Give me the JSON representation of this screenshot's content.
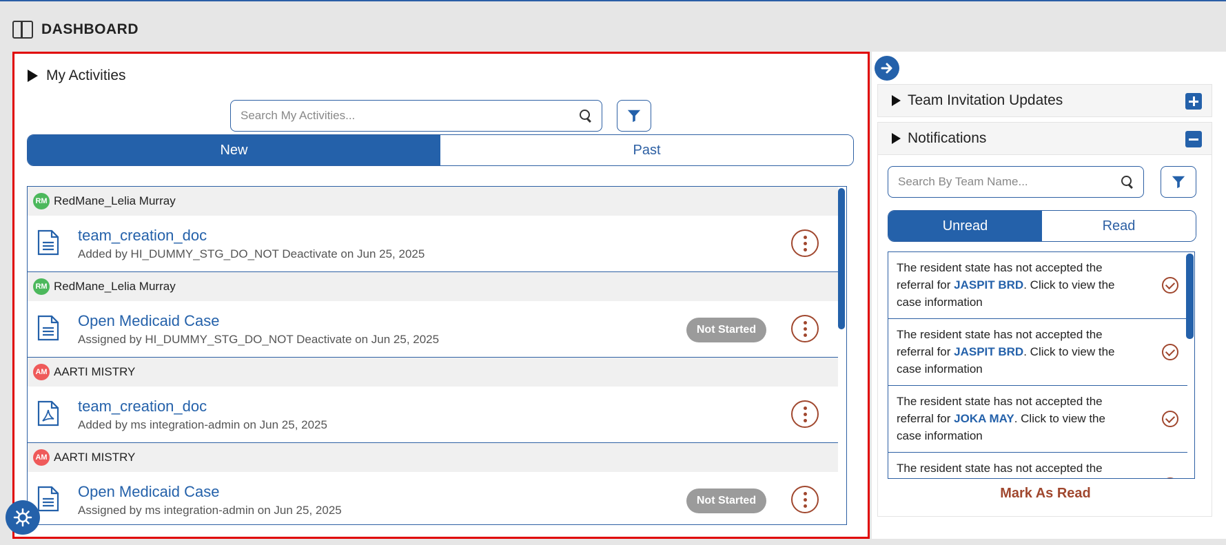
{
  "header": {
    "title": "DASHBOARD"
  },
  "activities": {
    "section_title": "My Activities",
    "search_placeholder": "Search My Activities...",
    "tabs": [
      {
        "label": "New",
        "active": true
      },
      {
        "label": "Past",
        "active": false
      }
    ],
    "items": [
      {
        "initials": "RM",
        "owner": "RedMane_Lelia Murray",
        "title": "team_creation_doc",
        "meta": "Added by HI_DUMMY_STG_DO_NOT Deactivate  on Jun 25, 2025",
        "status": "",
        "icon": "document-icon"
      },
      {
        "initials": "RM",
        "owner": "RedMane_Lelia Murray",
        "title": "Open Medicaid Case",
        "meta": "Assigned by HI_DUMMY_STG_DO_NOT Deactivate  on Jun 25, 2025",
        "status": "Not Started",
        "icon": "document-icon"
      },
      {
        "initials": "AM",
        "owner": "AARTI MISTRY",
        "title": "team_creation_doc",
        "meta": "Added by ms integration-admin  on Jun 25, 2025",
        "status": "",
        "icon": "pdf-icon"
      },
      {
        "initials": "AM",
        "owner": "AARTI MISTRY",
        "title": "Open Medicaid Case",
        "meta": "Assigned by ms integration-admin  on Jun 25, 2025",
        "status": "Not Started",
        "icon": "document-icon"
      }
    ]
  },
  "right": {
    "team_invitations_title": "Team Invitation Updates",
    "notifications_title": "Notifications",
    "search_placeholder": "Search By Team Name...",
    "tabs": [
      {
        "label": "Unread",
        "active": true
      },
      {
        "label": "Read",
        "active": false
      }
    ],
    "notifications": [
      {
        "prefix": "The resident state has not accepted the referral for ",
        "name": "JASPIT BRD",
        "suffix": ". Click to view the case information"
      },
      {
        "prefix": "The resident state has not accepted the referral for ",
        "name": "JASPIT BRD",
        "suffix": ". Click to view the case information"
      },
      {
        "prefix": "The resident state has not accepted the referral for ",
        "name": "JOKA MAY",
        "suffix": ". Click to view the case information"
      },
      {
        "prefix": "The resident state has not accepted the",
        "name": "",
        "suffix": ""
      }
    ],
    "mark_read_label": "Mark As Read"
  },
  "colors": {
    "primary": "#2461aa",
    "accent": "#a0472e",
    "highlight_border": "#e00000"
  }
}
